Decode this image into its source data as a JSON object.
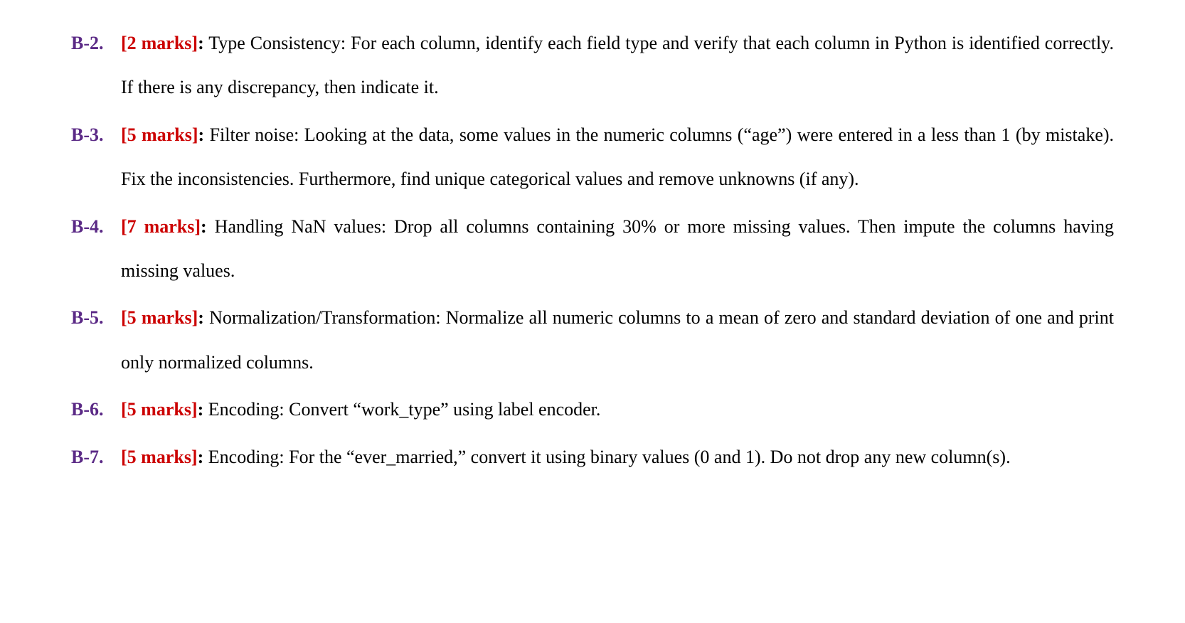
{
  "items": [
    {
      "number": "B-2.",
      "marks": "[2 marks]",
      "text": "Type Consistency: For each column, identify each field type and verify that each column in Python is identified correctly. If there is any discrepancy, then indicate it."
    },
    {
      "number": "B-3.",
      "marks": "[5 marks]",
      "text": "Filter noise: Looking at the data, some values in the numeric columns (“age”) were entered in a less than 1 (by mistake). Fix the inconsistencies. Furthermore, find unique categorical values and remove unknowns (if any)."
    },
    {
      "number": "B-4.",
      "marks": "[7 marks]",
      "text": "Handling NaN values: Drop all columns containing 30% or more missing values. Then impute the columns having missing values."
    },
    {
      "number": "B-5.",
      "marks": "[5 marks]",
      "text": "Normalization/Transformation: Normalize all numeric columns to a mean of zero and standard deviation of one and print only normalized columns."
    },
    {
      "number": "B-6.",
      "marks": "[5 marks]",
      "text": "Encoding: Convert “work_type” using label encoder."
    },
    {
      "number": "B-7.",
      "marks": "[5 marks]",
      "text": "Encoding: For the “ever_married,” convert it using binary values (0 and 1). Do not drop any new column(s)."
    }
  ],
  "colon": ":"
}
